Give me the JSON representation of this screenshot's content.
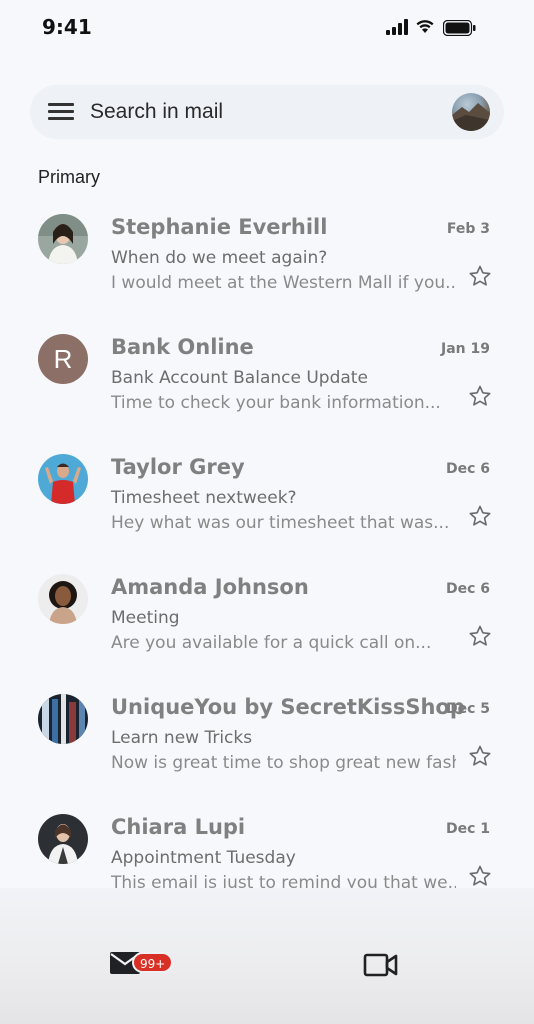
{
  "status": {
    "time": "9:41"
  },
  "search": {
    "placeholder": "Search in mail"
  },
  "section": {
    "label": "Primary"
  },
  "emails": [
    {
      "sender": "Stephanie Everhill",
      "date": "Feb 3",
      "subject": "When do we meet again?",
      "snippet": "I would meet at the Western Mall if you..",
      "avatar": "photo"
    },
    {
      "sender": "Bank Online",
      "date": "Jan 19",
      "subject": "Bank Account Balance Update",
      "snippet": "Time to check your bank information...",
      "avatar": "R"
    },
    {
      "sender": "Taylor Grey",
      "date": "Dec 6",
      "subject": "Timesheet nextweek?",
      "snippet": "Hey what was our timesheet that was...",
      "avatar": "photo"
    },
    {
      "sender": "Amanda Johnson",
      "date": "Dec 6",
      "subject": "Meeting",
      "snippet": "Are you available for a quick call on...",
      "avatar": "photo"
    },
    {
      "sender": "UniqueYou by SecretKissShop",
      "date": "Dec 5",
      "subject": "Learn new Tricks",
      "snippet": "Now is great time to shop great new fash..",
      "avatar": "photo"
    },
    {
      "sender": "Chiara Lupi",
      "date": "Dec 1",
      "subject": "Appointment Tuesday",
      "snippet": "This email is just to remind you that we...",
      "avatar": "photo"
    }
  ],
  "bottom_nav": {
    "mail_badge": "99+",
    "mail_icon": "mail-icon",
    "meet_icon": "video-camera-icon"
  },
  "colors": {
    "badge": "#d93025",
    "background": "#f6f8fc",
    "letter_avatar": "#8c6f67"
  }
}
